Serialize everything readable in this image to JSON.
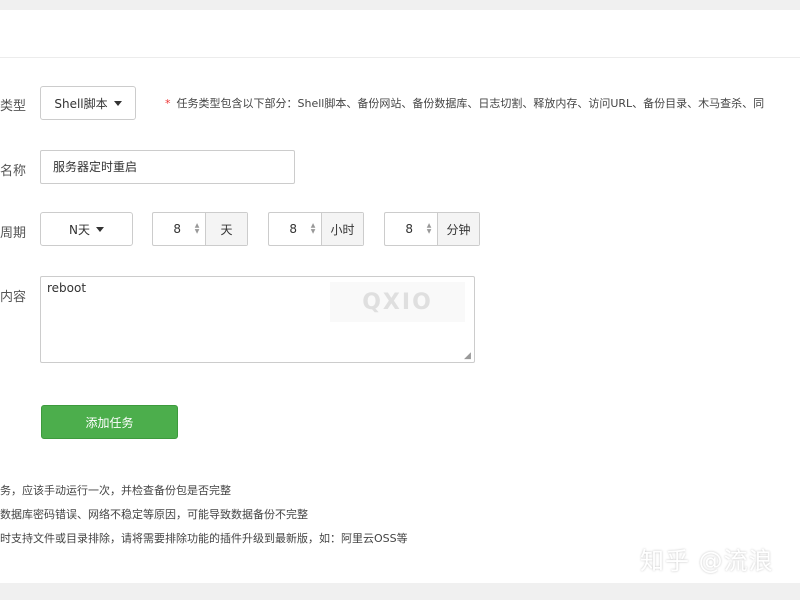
{
  "form": {
    "task_type": {
      "label": "类型",
      "selected": "Shell脚本",
      "hint_marker": "*",
      "hint": "任务类型包含以下部分：Shell脚本、备份网站、备份数据库、日志切割、释放内存、访问URL、备份目录、木马查杀、同"
    },
    "task_name": {
      "label": "名称",
      "value": "服务器定时重启"
    },
    "cycle": {
      "label": "周期",
      "selected": "N天",
      "days": {
        "value": "8",
        "unit": "天"
      },
      "hours": {
        "value": "8",
        "unit": "小时"
      },
      "minutes": {
        "value": "8",
        "unit": "分钟"
      }
    },
    "script": {
      "label": "内容",
      "value": "reboot",
      "watermark": "QXIO"
    },
    "submit_label": "添加任务"
  },
  "notes": [
    "务，应该手动运行一次，并检查备份包是否完整",
    "数据库密码错误、网络不稳定等原因，可能导致数据备份不完整",
    "时支持文件或目录排除，请将需要排除功能的插件升级到最新版，如：阿里云OSS等"
  ],
  "watermark_zhihu": "知乎 @流浪",
  "colors": {
    "primary_green": "#4cae4c",
    "required_star": "#e33333",
    "page_bg": "#f0f0f0"
  }
}
